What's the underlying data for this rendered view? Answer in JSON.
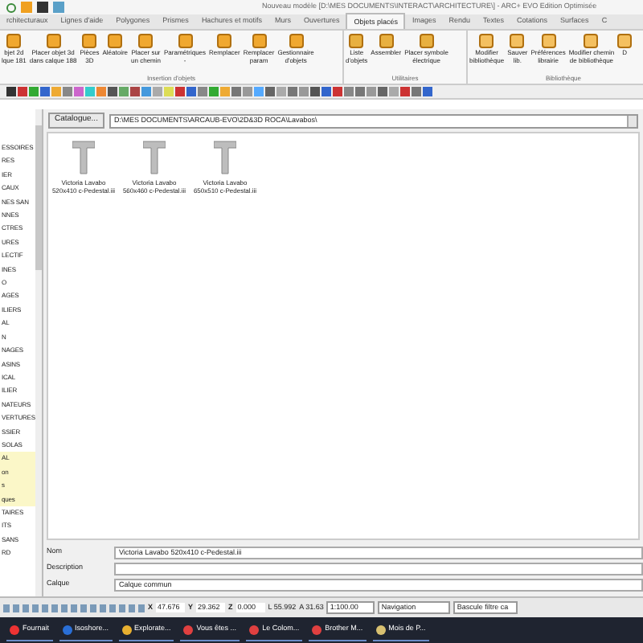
{
  "title_bar": {
    "title": "Nouveau modèle [D:\\MES DOCUMENTS\\INTERACT\\ARCHITECTURE\\] - ARC+ EVO Edition Optimisée"
  },
  "ribbon_tabs": [
    {
      "label": "rchitecturaux",
      "selected": false
    },
    {
      "label": "Lignes d'aide",
      "selected": false
    },
    {
      "label": "Polygones",
      "selected": false
    },
    {
      "label": "Prismes",
      "selected": false
    },
    {
      "label": "Hachures et motifs",
      "selected": false
    },
    {
      "label": "Murs",
      "selected": false
    },
    {
      "label": "Ouvertures",
      "selected": false
    },
    {
      "label": "Objets placés",
      "selected": true
    },
    {
      "label": "Images",
      "selected": false
    },
    {
      "label": "Rendu",
      "selected": false
    },
    {
      "label": "Textes",
      "selected": false
    },
    {
      "label": "Cotations",
      "selected": false
    },
    {
      "label": "Surfaces",
      "selected": false
    },
    {
      "label": "C",
      "selected": false
    }
  ],
  "ribbon_groups": [
    {
      "label": "Insertion d'objets",
      "buttons": [
        "bjet 2d\nlque 181",
        "Placer objet 3d\ndans calque 188",
        "Pièces\n3D",
        "Aléatoire",
        "Placer sur\nun chemin",
        "Paramétriques\n-",
        "Remplacer",
        "Remplacer\nparam",
        "Gestionnaire\nd'objets"
      ]
    },
    {
      "label": "Utilitaires",
      "buttons": [
        "Liste\nd'objets",
        "Assembler",
        "Placer symbole\nélectrique"
      ]
    },
    {
      "label": "Bibliothèque",
      "buttons": [
        "Modifier\nbibliothèque",
        "Sauver\nlib.",
        "Préférences\nlibrairie",
        "Modifier chemin\nde bibliothèque",
        "D"
      ]
    }
  ],
  "sidebar": {
    "items": [
      {
        "label": "ESSOIRES",
        "highlighted": false
      },
      {
        "label": "RES",
        "highlighted": false
      },
      {
        "label": "IER",
        "highlighted": false
      },
      {
        "label": "CAUX",
        "highlighted": false
      },
      {
        "label": "NES SAN",
        "highlighted": false
      },
      {
        "label": "NNES",
        "highlighted": false
      },
      {
        "label": "CTRES",
        "highlighted": false
      },
      {
        "label": "URES",
        "highlighted": false
      },
      {
        "label": "LECTIF",
        "highlighted": false
      },
      {
        "label": "INES",
        "highlighted": false
      },
      {
        "label": "O",
        "highlighted": false
      },
      {
        "label": "AGES",
        "highlighted": false
      },
      {
        "label": "ILIERS",
        "highlighted": false
      },
      {
        "label": "AL",
        "highlighted": false
      },
      {
        "label": "N",
        "highlighted": false
      },
      {
        "label": "NAGES",
        "highlighted": false
      },
      {
        "label": "ASINS",
        "highlighted": false
      },
      {
        "label": "ICAL",
        "highlighted": false
      },
      {
        "label": "ILIER",
        "highlighted": false
      },
      {
        "label": "NATEURS",
        "highlighted": false
      },
      {
        "label": "VERTURES",
        "highlighted": false
      },
      {
        "label": "SSIER",
        "highlighted": false
      },
      {
        "label": "SOLAS",
        "highlighted": false
      },
      {
        "label": "AL",
        "highlighted": true
      },
      {
        "label": "on",
        "highlighted": true
      },
      {
        "label": "s",
        "highlighted": true
      },
      {
        "label": "ques",
        "highlighted": true
      },
      {
        "label": "TAIRES",
        "highlighted": false
      },
      {
        "label": "ITS",
        "highlighted": false
      },
      {
        "label": "SANS",
        "highlighted": false
      },
      {
        "label": "RD",
        "highlighted": false
      }
    ]
  },
  "catalogue": {
    "button": "Catalogue...",
    "path": "D:\\MES DOCUMENTS\\ARCAUB-EVO\\2D&3D ROCA\\Lavabos\\"
  },
  "objects": [
    {
      "name": "Victoria Lavabo",
      "file": "520x410 c-Pedestal.iii"
    },
    {
      "name": "Victoria Lavabo",
      "file": "560x460 c-Pedestal.iii"
    },
    {
      "name": "Victoria Lavabo",
      "file": "650x510 c-Pedestal.iii"
    }
  ],
  "form": [
    {
      "label": "Nom",
      "value": "Victoria Lavabo 520x410 c-Pedestal.iii"
    },
    {
      "label": "Description"
    },
    {
      "label": "Calque",
      "value": "Calque commun"
    }
  ],
  "status_bar": {
    "coordinates": [
      {
        "axis": "X",
        "value": "47.676"
      },
      {
        "axis": "Y",
        "value": "29.362"
      },
      {
        "axis": "Z",
        "value": "0.000"
      }
    ],
    "l": "L 55.992",
    "a": "A 31.63",
    "scale": "1:100.00",
    "mode": "Navigation",
    "filter": "Bascule filtre ca"
  },
  "taskbar": [
    {
      "label": "Fournait"
    },
    {
      "label": "Isoshore..."
    },
    {
      "label": "Explorate..."
    },
    {
      "label": "Vous êtes ..."
    },
    {
      "label": "Le Colom..."
    },
    {
      "label": "Brother M..."
    },
    {
      "label": "Mois de P..."
    }
  ]
}
